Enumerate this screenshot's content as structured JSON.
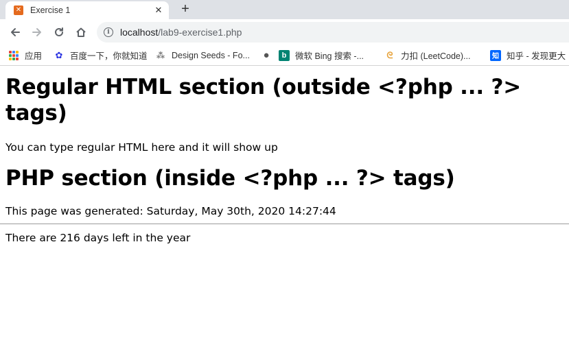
{
  "browser": {
    "tab": {
      "title": "Exercise 1",
      "close": "✕"
    },
    "new_tab": "+",
    "address": {
      "host": "localhost",
      "path": "/lab9-exercise1.php"
    },
    "bookmarks": [
      {
        "label": "应用",
        "icon": "apps-grid-icon"
      },
      {
        "label": "百度一下，你就知道",
        "icon": "baidu-paw-icon"
      },
      {
        "label": "Design Seeds - Fo...",
        "icon": "design-seeds-icon"
      },
      {
        "label": "",
        "icon": "globe-icon"
      },
      {
        "label": "微软 Bing 搜索 -...",
        "icon": "bing-icon"
      },
      {
        "label": "力扣 (LeetCode)...",
        "icon": "leetcode-icon"
      },
      {
        "label": "知乎 - 发现更大",
        "icon": "zhihu-icon"
      }
    ]
  },
  "page": {
    "heading_regular": "Regular HTML section (outside <?php ... ?> tags)",
    "regular_text": "You can type regular HTML here and it will show up",
    "heading_php": "PHP section (inside <?php ... ?> tags)",
    "generated_text": "This page was generated: Saturday, May 30th, 2020 14:27:44",
    "days_left_text": "There are 216 days left in the year"
  },
  "colors": {
    "tabstrip": "#dee1e6",
    "omnibox": "#f1f3f4",
    "favicon": "#e46a1e",
    "bing": "#008373",
    "zhihu": "#0066ff"
  }
}
